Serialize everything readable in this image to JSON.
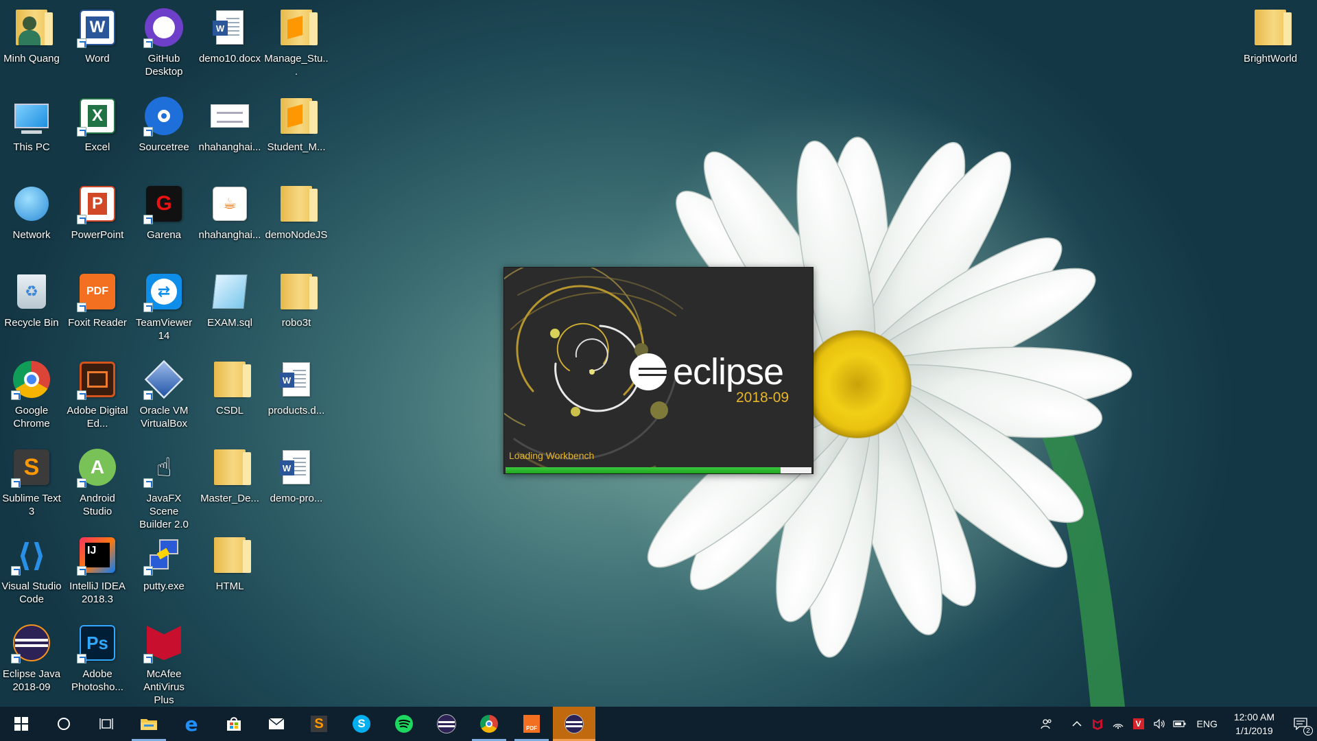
{
  "desktop": {
    "icons": [
      {
        "label": "Minh Quang",
        "icon": "user-folder-icon"
      },
      {
        "label": "Word",
        "icon": "word-icon"
      },
      {
        "label": "GitHub Desktop",
        "icon": "github-icon"
      },
      {
        "label": "demo10.docx",
        "icon": "word-document-icon"
      },
      {
        "label": "Manage_Stu...",
        "icon": "sublime-folder-icon"
      },
      {
        "label": "This PC",
        "icon": "computer-icon"
      },
      {
        "label": "Excel",
        "icon": "excel-icon"
      },
      {
        "label": "Sourcetree",
        "icon": "sourcetree-icon"
      },
      {
        "label": "nhahanghai...",
        "icon": "image-file-icon"
      },
      {
        "label": "Student_M...",
        "icon": "sublime-folder-icon"
      },
      {
        "label": "Network",
        "icon": "network-icon"
      },
      {
        "label": "PowerPoint",
        "icon": "powerpoint-icon"
      },
      {
        "label": "Garena",
        "icon": "garena-icon"
      },
      {
        "label": "nhahanghai...",
        "icon": "java-file-icon"
      },
      {
        "label": "demoNodeJS",
        "icon": "folder-icon"
      },
      {
        "label": "Recycle Bin",
        "icon": "recycle-bin-icon"
      },
      {
        "label": "Foxit Reader",
        "icon": "foxit-reader-icon"
      },
      {
        "label": "TeamViewer 14",
        "icon": "teamviewer-icon"
      },
      {
        "label": "EXAM.sql",
        "icon": "sql-file-icon"
      },
      {
        "label": "robo3t",
        "icon": "folder-icon"
      },
      {
        "label": "Google Chrome",
        "icon": "chrome-icon"
      },
      {
        "label": "Adobe Digital Ed...",
        "icon": "adobe-digital-editions-icon"
      },
      {
        "label": "Oracle VM VirtualBox",
        "icon": "virtualbox-icon"
      },
      {
        "label": "CSDL",
        "icon": "folder-icon"
      },
      {
        "label": "products.d...",
        "icon": "word-document-icon"
      },
      {
        "label": "Sublime Text 3",
        "icon": "sublime-text-icon"
      },
      {
        "label": "Android Studio",
        "icon": "android-studio-icon"
      },
      {
        "label": "JavaFX Scene Builder 2.0",
        "icon": "scene-builder-icon"
      },
      {
        "label": "Master_De...",
        "icon": "folder-icon"
      },
      {
        "label": "demo-pro...",
        "icon": "word-document-icon"
      },
      {
        "label": "Visual Studio Code",
        "icon": "vscode-icon"
      },
      {
        "label": "IntelliJ IDEA 2018.3",
        "icon": "intellij-icon"
      },
      {
        "label": "putty.exe",
        "icon": "putty-icon"
      },
      {
        "label": "HTML",
        "icon": "folder-icon"
      },
      {
        "label": "Eclipse Java 2018-09",
        "icon": "eclipse-icon"
      },
      {
        "label": "Adobe Photosho...",
        "icon": "photoshop-icon"
      },
      {
        "label": "McAfee AntiVirus Plus",
        "icon": "mcafee-icon"
      },
      {
        "label": "BrightWorld",
        "icon": "folder-icon"
      }
    ]
  },
  "splash": {
    "brand": "eclipse",
    "version": "2018-09",
    "status": "Loading Workbench",
    "progress": 0.9,
    "accent_color": "#e8b62a",
    "progress_color": "#2db92f"
  },
  "taskbar": {
    "buttons": [
      {
        "name": "start-button",
        "icon": "windows-logo-icon"
      },
      {
        "name": "cortana-button",
        "icon": "search-circle-icon"
      },
      {
        "name": "task-view-button",
        "icon": "task-view-icon"
      },
      {
        "name": "file-explorer-button",
        "icon": "folder-icon",
        "running": true
      },
      {
        "name": "edge-button",
        "icon": "edge-icon"
      },
      {
        "name": "store-button",
        "icon": "store-icon"
      },
      {
        "name": "mail-button",
        "icon": "mail-icon"
      },
      {
        "name": "sublime-button",
        "icon": "sublime-text-icon"
      },
      {
        "name": "skype-button",
        "icon": "skype-icon"
      },
      {
        "name": "spotify-button",
        "icon": "spotify-icon"
      },
      {
        "name": "eclipse-pinned-button",
        "icon": "eclipse-icon"
      },
      {
        "name": "chrome-button",
        "icon": "chrome-icon",
        "running": true
      },
      {
        "name": "foxit-button",
        "icon": "foxit-reader-icon",
        "running": true
      },
      {
        "name": "eclipse-running-button",
        "icon": "eclipse-icon",
        "active": true
      }
    ],
    "tray": {
      "language": "ENG",
      "time": "12:00 AM",
      "date": "1/1/2019",
      "notification_count": "2"
    }
  }
}
